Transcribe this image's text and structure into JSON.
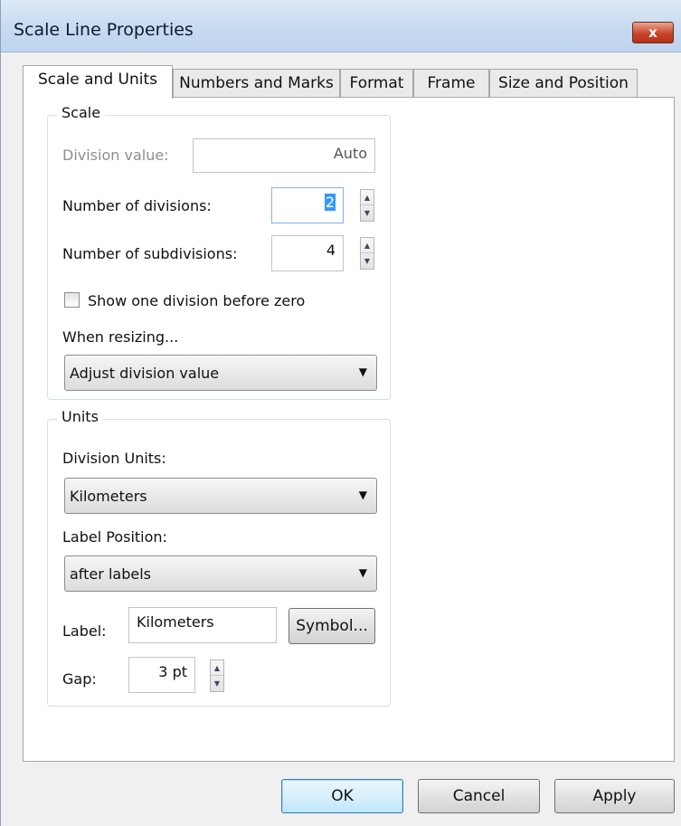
{
  "window": {
    "title": "Scale Line Properties",
    "close_label": "x"
  },
  "tabs": [
    {
      "label": "Scale and Units"
    },
    {
      "label": "Numbers and Marks"
    },
    {
      "label": "Format"
    },
    {
      "label": "Frame"
    },
    {
      "label": "Size and Position"
    }
  ],
  "scale": {
    "legend": "Scale",
    "division_value_label": "Division value:",
    "division_value": "Auto",
    "num_divisions_label": "Number of divisions:",
    "num_divisions": "2",
    "num_subdivisions_label": "Number of subdivisions:",
    "num_subdivisions": "4",
    "show_one_division_label": "Show one division before zero",
    "show_one_division_checked": false,
    "when_resizing_label": "When resizing...",
    "when_resizing_value": "Adjust division value"
  },
  "units": {
    "legend": "Units",
    "division_units_label": "Division Units:",
    "division_units_value": "Kilometers",
    "label_position_label": "Label Position:",
    "label_position_value": "after labels",
    "label_label": "Label:",
    "label_value": "Kilometers",
    "symbol_button": "Symbol...",
    "gap_label": "Gap:",
    "gap_value": "3 pt"
  },
  "footer": {
    "ok": "OK",
    "cancel": "Cancel",
    "apply": "Apply"
  },
  "icons": {
    "close": "close-icon",
    "spin_up": "spin-up-icon",
    "spin_down": "spin-down-icon",
    "dropdown": "dropdown-arrow-icon"
  },
  "colors": {
    "titlebar": "#c7daf0",
    "close_button": "#c9452c",
    "default_button_border": "#3c7fb1"
  }
}
